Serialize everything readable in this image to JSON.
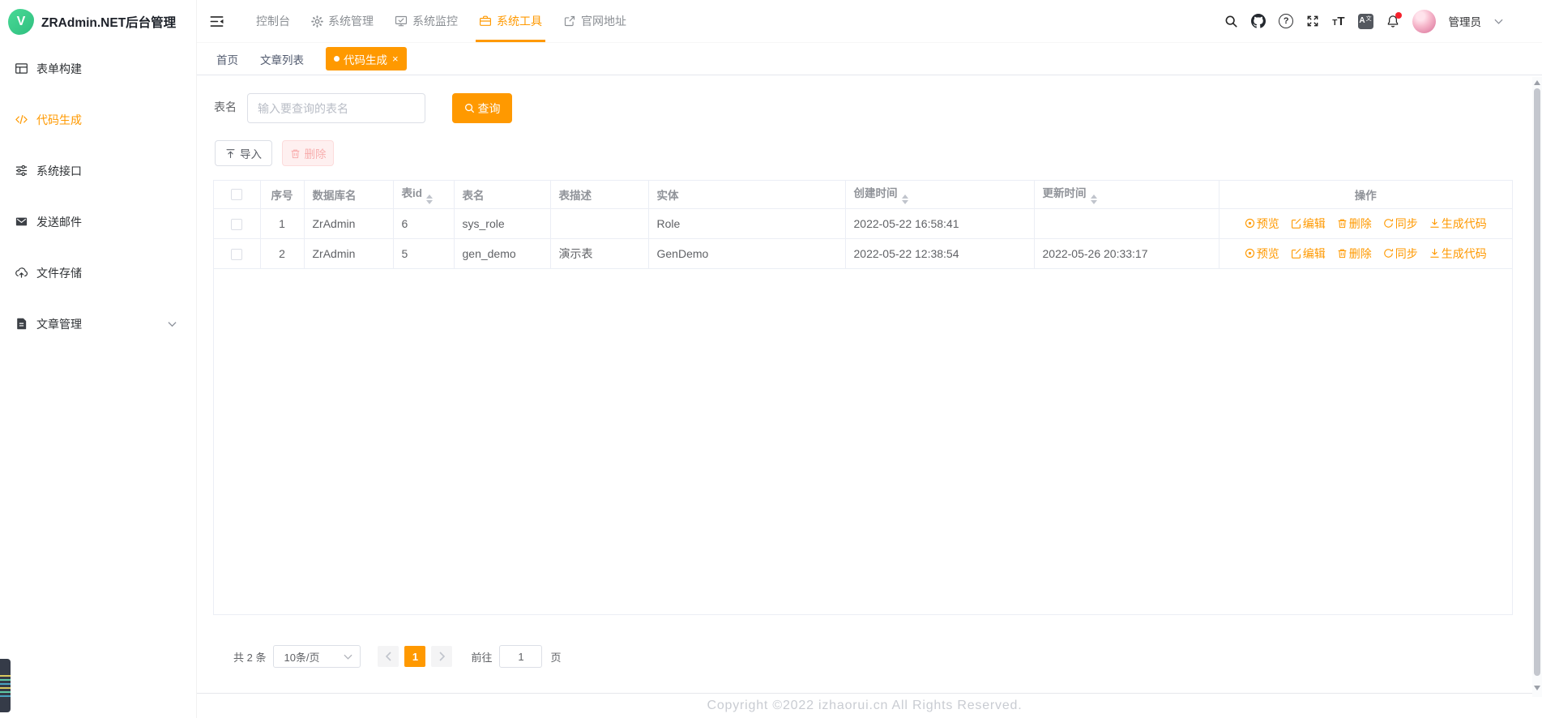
{
  "app": {
    "title": "ZRAdmin.NET后台管理",
    "logo_letter": "V"
  },
  "colors": {
    "accent": "#ff9900",
    "logo_green": "#3ac279",
    "danger_light_bg": "#fef0f0",
    "badge_red": "#f5222d"
  },
  "sidebar": {
    "items": [
      {
        "label": "表单构建",
        "icon": "form-grid-icon"
      },
      {
        "label": "代码生成",
        "icon": "code-icon",
        "active": true
      },
      {
        "label": "系统接口",
        "icon": "sliders-icon"
      },
      {
        "label": "发送邮件",
        "icon": "mail-icon"
      },
      {
        "label": "文件存储",
        "icon": "cloud-upload-icon"
      },
      {
        "label": "文章管理",
        "icon": "document-icon",
        "expandable": true
      }
    ]
  },
  "header": {
    "nav": [
      {
        "label": "控制台"
      },
      {
        "label": "系统管理",
        "icon": "gear-icon"
      },
      {
        "label": "系统监控",
        "icon": "monitor-icon"
      },
      {
        "label": "系统工具",
        "icon": "toolbox-icon",
        "active": true
      },
      {
        "label": "官网地址",
        "icon": "external-link-icon"
      }
    ],
    "icons": [
      {
        "name": "search-icon"
      },
      {
        "name": "github-icon"
      },
      {
        "name": "help-icon",
        "glyph": "?"
      },
      {
        "name": "fullscreen-icon"
      },
      {
        "name": "font-size-icon",
        "glyph_small": "T",
        "glyph_large": "T"
      },
      {
        "name": "translate-icon",
        "glyph": "A",
        "glyph_sub": "文"
      },
      {
        "name": "bell-icon",
        "has_badge": true
      }
    ],
    "user_name": "管理员"
  },
  "tabs": {
    "items": [
      {
        "label": "首页"
      },
      {
        "label": "文章列表"
      },
      {
        "label": "代码生成",
        "active": true,
        "close": "×"
      }
    ]
  },
  "toolbar": {
    "table_name_label": "表名",
    "search_placeholder": "输入要查询的表名",
    "query_label": "查询",
    "import_label": "导入",
    "delete_label": "删除"
  },
  "table": {
    "columns": {
      "seq": "序号",
      "db": "数据库名",
      "table_id": "表id",
      "name": "表名",
      "desc": "表描述",
      "entity": "实体",
      "created": "创建时间",
      "updated": "更新时间",
      "actions": "操作"
    },
    "rows": [
      {
        "seq": "1",
        "db": "ZrAdmin",
        "table_id": "6",
        "name": "sys_role",
        "desc": "",
        "entity": "Role",
        "created": "2022-05-22 16:58:41",
        "updated": ""
      },
      {
        "seq": "2",
        "db": "ZrAdmin",
        "table_id": "5",
        "name": "gen_demo",
        "desc": "演示表",
        "entity": "GenDemo",
        "created": "2022-05-22 12:38:54",
        "updated": "2022-05-26 20:33:17"
      }
    ],
    "row_actions": [
      {
        "label": "预览",
        "icon": "view-icon"
      },
      {
        "label": "编辑",
        "icon": "edit-icon"
      },
      {
        "label": "删除",
        "icon": "trash-icon"
      },
      {
        "label": "同步",
        "icon": "sync-icon"
      },
      {
        "label": "生成代码",
        "icon": "download-icon"
      }
    ]
  },
  "pagination": {
    "total": "共 2 条",
    "page_size": "10条/页",
    "current": "1",
    "goto_label": "前往",
    "goto_value": "1",
    "unit_label": "页"
  },
  "footer": {
    "copyright": "Copyright ©2022 izhaorui.cn All Rights Reserved."
  }
}
